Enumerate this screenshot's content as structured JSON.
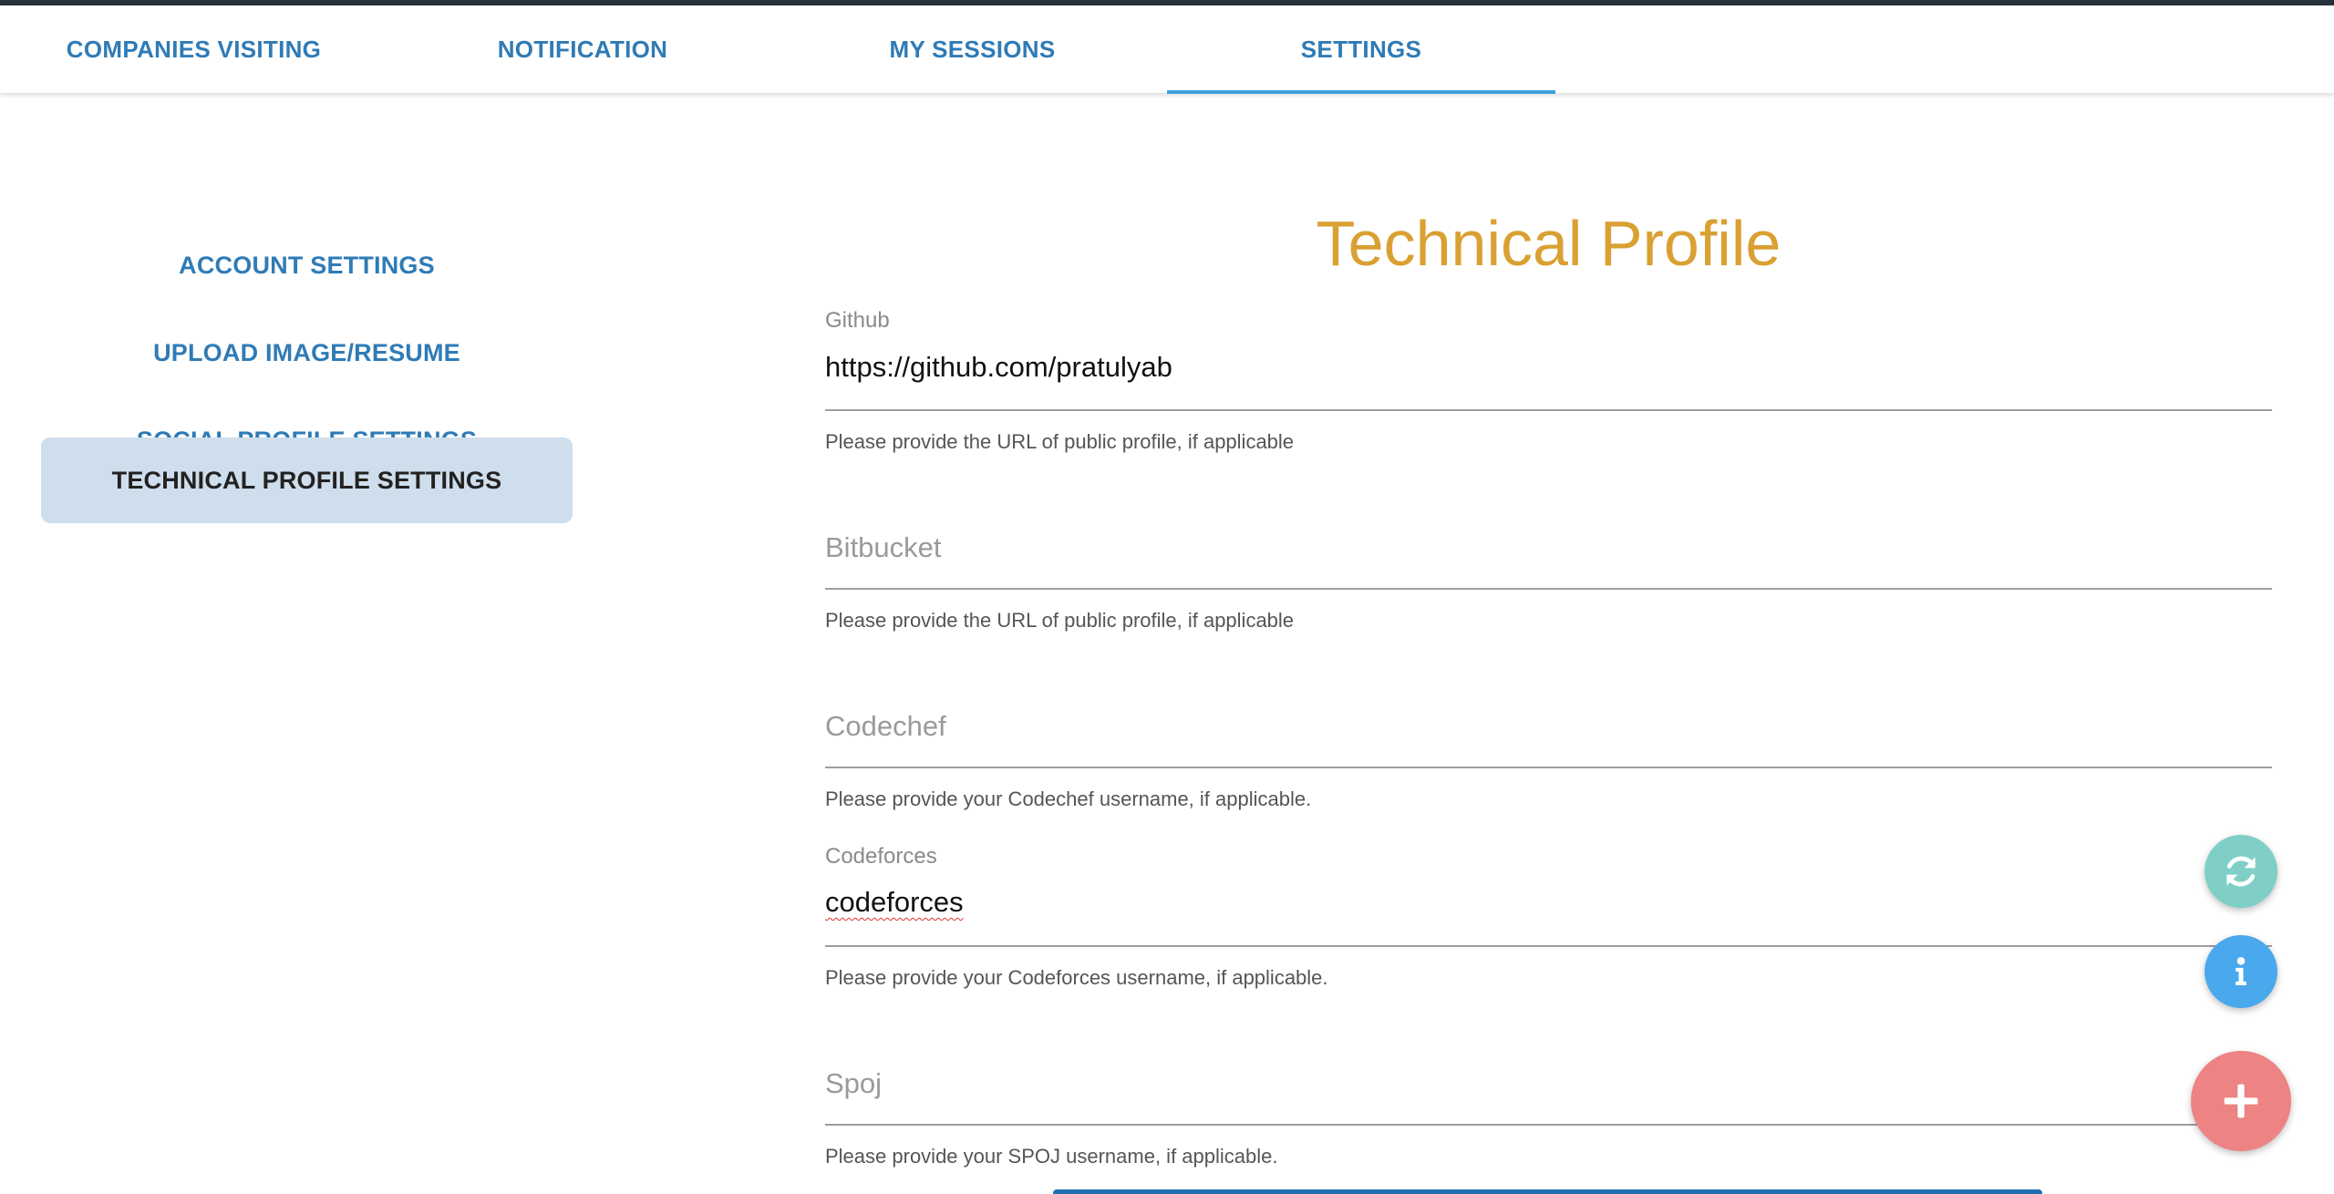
{
  "tabs": [
    {
      "label": "COMPANIES VISITING",
      "active": false
    },
    {
      "label": "NOTIFICATION",
      "active": false
    },
    {
      "label": "MY SESSIONS",
      "active": false
    },
    {
      "label": "SETTINGS",
      "active": true
    }
  ],
  "sidebar": {
    "items": [
      {
        "label": "ACCOUNT SETTINGS",
        "active": false
      },
      {
        "label": "UPLOAD IMAGE/RESUME",
        "active": false
      },
      {
        "label": "SOCIAL PROFILE SETTINGS",
        "active": false
      },
      {
        "label": "TECHNICAL PROFILE SETTINGS",
        "active": true
      }
    ]
  },
  "main": {
    "title": "Technical Profile",
    "fields": [
      {
        "label": "Github",
        "value": "https://github.com/pratulyab",
        "help": "Please provide the URL of public profile, if applicable"
      },
      {
        "label": "Bitbucket",
        "value": "",
        "help": "Please provide the URL of public profile, if applicable"
      },
      {
        "label": "Codechef",
        "value": "",
        "help": "Please provide your Codechef username, if applicable."
      },
      {
        "label": "Codeforces",
        "value": "codeforces",
        "help": "Please provide your Codeforces username, if applicable."
      },
      {
        "label": "Spoj",
        "value": "",
        "help": "Please provide your SPOJ username, if applicable."
      }
    ]
  },
  "fabs": {
    "refresh": {
      "icon": "refresh-icon",
      "color": "#7fcfc6"
    },
    "info": {
      "icon": "info-icon",
      "color": "#4aa8ec"
    },
    "add": {
      "icon": "plus-icon",
      "color": "#ee8383"
    }
  },
  "colors": {
    "accent": "#2f7bb6",
    "title": "#d9a032",
    "tab_indicator": "#3ea2da",
    "active_sidebar_bg": "#cfdeec"
  }
}
